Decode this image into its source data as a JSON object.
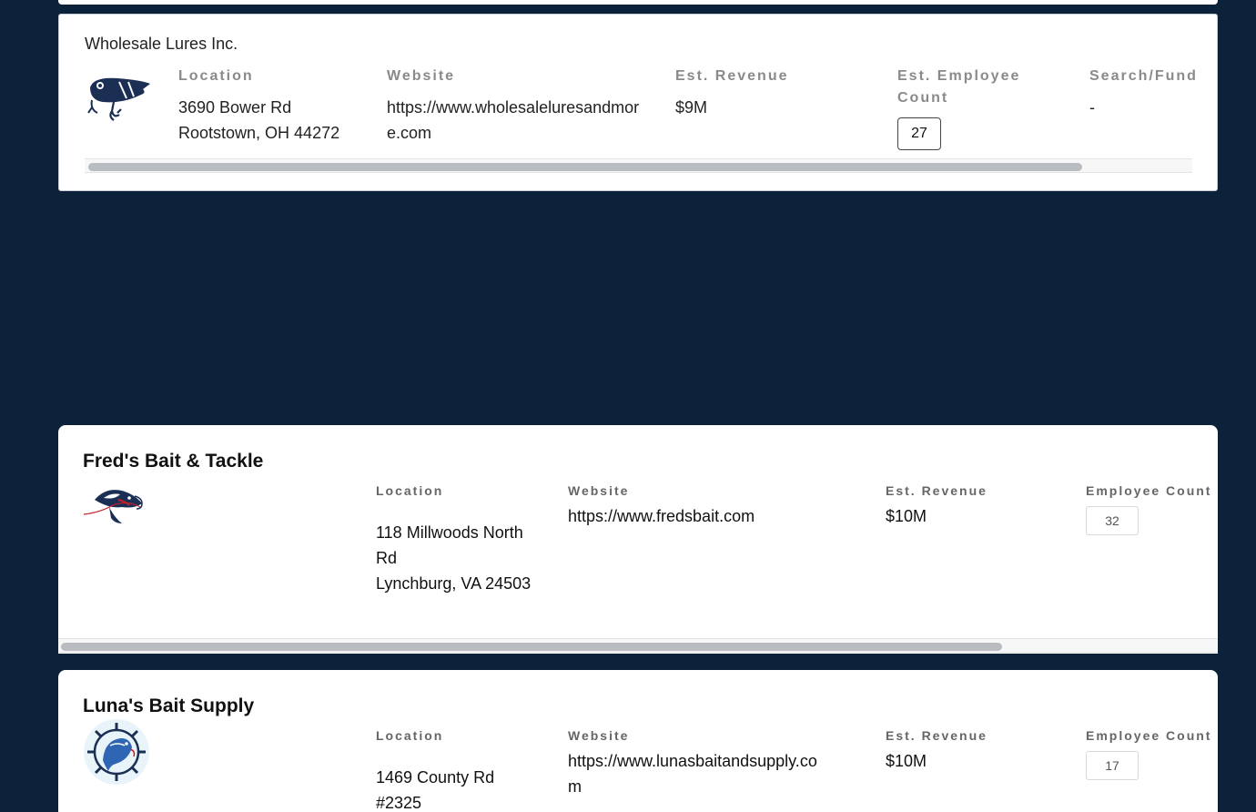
{
  "cards": [
    {
      "name": "Wholesale Lures Inc.",
      "logo": "fishing-lure-icon",
      "labels": {
        "location": "Location",
        "website": "Website",
        "revenue": "Est. Revenue",
        "employees_line1": "Est. Employee",
        "employees_line2": "Count",
        "search": "Search/Fund"
      },
      "address_line1": "3690 Bower Rd",
      "address_line2": "Rootstown, OH 44272",
      "website_line1": "https://www.wholesaleluresandmor",
      "website_line2": "e.com",
      "revenue": "$9M",
      "employee_count": "27",
      "search_fund": "-"
    },
    {
      "name": "Fred's Bait & Tackle",
      "logo": "fish-hook-logo",
      "labels": {
        "location": "Location",
        "website": "Website",
        "revenue": "Est. Revenue",
        "employees": "Employee Count"
      },
      "address_line1": "118 Millwoods North",
      "address_line2": "Rd",
      "address_line3": "Lynchburg, VA 24503",
      "website": "https://www.fredsbait.com",
      "revenue": "$10M",
      "employee_count": "32"
    },
    {
      "name": "Luna's Bait Supply",
      "logo": "fish-wheel-logo",
      "labels": {
        "location": "Location",
        "website": "Website",
        "revenue": "Est. Revenue",
        "employees": "Employee Count"
      },
      "address_line1": "1469 County Rd",
      "address_line2": "#2325",
      "website_line1": "https://www.lunasbaitandsupply.co",
      "website_line2": "m",
      "revenue": "$10M",
      "employee_count": "17"
    }
  ],
  "colors": {
    "background": "#0b223a",
    "card": "#ffffff",
    "scrollbar_thumb": "#b9bcc0",
    "logo_navy": "#1b2f55"
  }
}
